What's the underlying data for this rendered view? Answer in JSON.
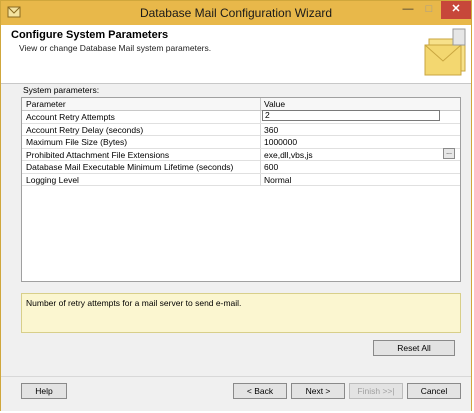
{
  "window": {
    "title": "Database Mail Configuration Wizard"
  },
  "header": {
    "title": "Configure System Parameters",
    "subtitle": "View or change Database Mail system parameters."
  },
  "section_label": "System parameters:",
  "grid": {
    "columns": [
      "Parameter",
      "Value"
    ],
    "rows": [
      {
        "parameter": "Account Retry Attempts",
        "value": "2"
      },
      {
        "parameter": "Account Retry Delay (seconds)",
        "value": "360"
      },
      {
        "parameter": "Maximum File Size (Bytes)",
        "value": "1000000"
      },
      {
        "parameter": "Prohibited Attachment File Extensions",
        "value": "exe,dll,vbs,js"
      },
      {
        "parameter": "Database Mail Executable Minimum Lifetime (seconds)",
        "value": "600"
      },
      {
        "parameter": "Logging Level",
        "value": "Normal"
      }
    ],
    "ellipsis_label": "..."
  },
  "description": "Number of retry attempts for a mail server to send e-mail.",
  "buttons": {
    "reset": "Reset All",
    "help": "Help",
    "back": "< Back",
    "next": "Next >",
    "finish": "Finish >>|",
    "cancel": "Cancel"
  },
  "titlebar_buttons": {
    "minimize": "—",
    "maximize": "□",
    "close": "✕"
  },
  "colors": {
    "titlebar": "#e8b84a",
    "close": "#c7473a",
    "description_bg": "#fbf6d0"
  }
}
